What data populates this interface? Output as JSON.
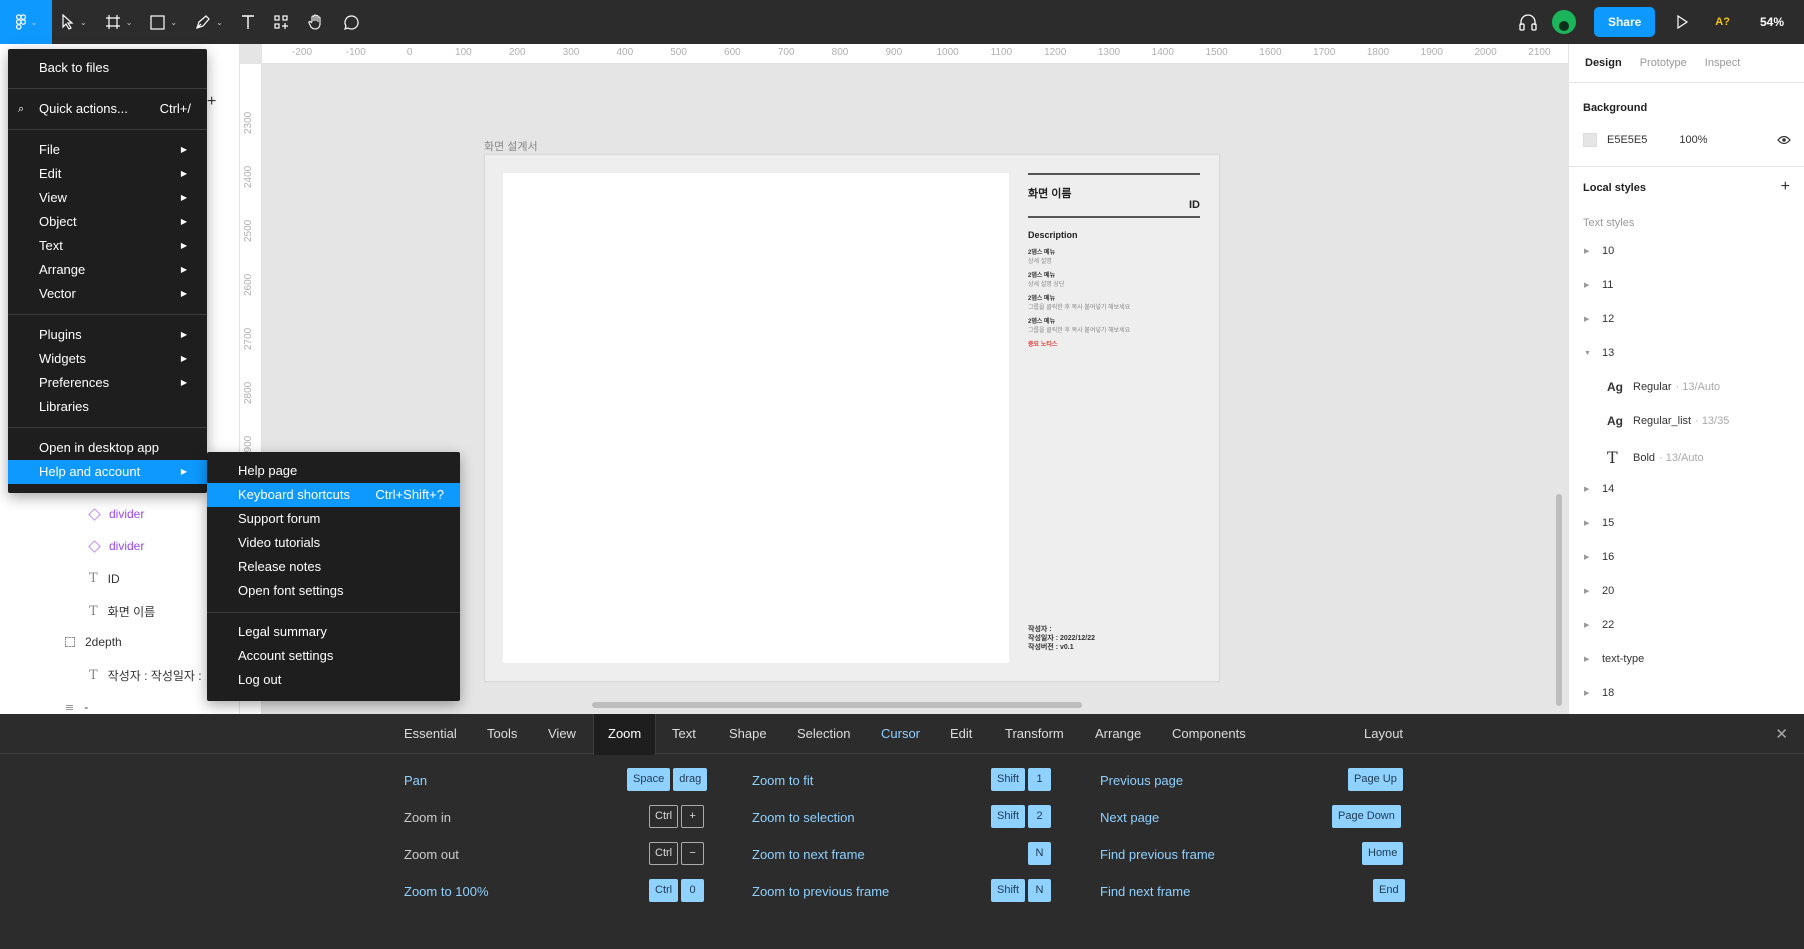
{
  "toolbar": {
    "share_label": "Share",
    "font_warning": "A?",
    "zoom": "54%"
  },
  "ruler": {
    "top_ticks": [
      "-200",
      "-100",
      "0",
      "100",
      "200",
      "300",
      "400",
      "500",
      "600",
      "700",
      "800",
      "900",
      "1000",
      "1100",
      "1200",
      "1300",
      "1400",
      "1500",
      "1600",
      "1700",
      "1800",
      "1900",
      "2000",
      "2100"
    ],
    "left_ticks": [
      "2300",
      "2400",
      "2500",
      "2600",
      "2700",
      "2800",
      "2900"
    ]
  },
  "layers": {
    "items": [
      {
        "label": "divider"
      },
      {
        "label": "divider"
      },
      {
        "label": "ID"
      },
      {
        "label": "화면 이름"
      },
      {
        "label": "2depth"
      },
      {
        "label": "작성자 : 작성일자 :"
      },
      {
        "label": "-"
      }
    ]
  },
  "canvas": {
    "frame_label": "화면 설계서",
    "screen_title": "화면 이름",
    "screen_id": "ID",
    "description": "Description",
    "depths": [
      {
        "head": "2뎁스 메뉴",
        "sub": "상세 설명"
      },
      {
        "head": "2뎁스 메뉴",
        "sub": "상세 설명 상단"
      },
      {
        "head": "2뎁스 메뉴",
        "sub": "그룹을 클릭한 후 복사 붙여넣기 해보세요"
      },
      {
        "head": "2뎁스 메뉴",
        "sub": "그룹을 클릭한 후 복사 붙여넣기 해보세요"
      }
    ],
    "notice": "중요 노티스",
    "footer_author": "작성자 :",
    "footer_date": "작성일자 : 2022/12/22",
    "footer_version": "작성버전 : v0.1"
  },
  "right_panel": {
    "tabs": [
      "Design",
      "Prototype",
      "Inspect"
    ],
    "background_title": "Background",
    "bg_hex": "E5E5E5",
    "bg_opacity": "100%",
    "local_styles_title": "Local styles",
    "text_styles_title": "Text styles",
    "style_groups": [
      "10",
      "11",
      "12",
      "13",
      "14",
      "15",
      "16",
      "20",
      "22",
      "text-type",
      "18"
    ],
    "expanded_styles": [
      {
        "icon": "Ag",
        "name": "Regular",
        "meta": "· 13/Auto"
      },
      {
        "icon": "Ag",
        "name": "Regular_list",
        "meta": "· 13/35"
      },
      {
        "icon": "T",
        "name": "Bold",
        "meta": "· 13/Auto"
      }
    ]
  },
  "main_menu": {
    "back": "Back to files",
    "quick_actions": "Quick actions...",
    "quick_actions_shortcut": "Ctrl+/",
    "file": "File",
    "edit": "Edit",
    "view": "View",
    "object": "Object",
    "text": "Text",
    "arrange": "Arrange",
    "vector": "Vector",
    "plugins": "Plugins",
    "widgets": "Widgets",
    "preferences": "Preferences",
    "libraries": "Libraries",
    "open_desktop": "Open in desktop app",
    "help_account": "Help and account"
  },
  "help_menu": {
    "help_page": "Help page",
    "keyboard_shortcuts": "Keyboard shortcuts",
    "keyboard_shortcuts_key": "Ctrl+Shift+?",
    "support_forum": "Support forum",
    "video_tutorials": "Video tutorials",
    "release_notes": "Release notes",
    "font_settings": "Open font settings",
    "legal_summary": "Legal summary",
    "account_settings": "Account settings",
    "log_out": "Log out"
  },
  "shortcuts": {
    "tabs": [
      "Essential",
      "Tools",
      "View",
      "Zoom",
      "Text",
      "Shape",
      "Selection",
      "Cursor",
      "Edit",
      "Transform",
      "Arrange",
      "Components",
      "Layout"
    ],
    "active_tab": "Zoom",
    "col1": [
      {
        "label": "Pan",
        "keys": [
          "Space",
          "drag"
        ]
      },
      {
        "label": "Zoom in",
        "keys": [
          "Ctrl",
          "+"
        ]
      },
      {
        "label": "Zoom out",
        "keys": [
          "Ctrl",
          "−"
        ]
      },
      {
        "label": "Zoom to 100%",
        "keys": [
          "Ctrl",
          "0"
        ]
      }
    ],
    "col2": [
      {
        "label": "Zoom to fit",
        "keys": [
          "Shift",
          "1"
        ]
      },
      {
        "label": "Zoom to selection",
        "keys": [
          "Shift",
          "2"
        ]
      },
      {
        "label": "Zoom to next frame",
        "keys": [
          "N"
        ]
      },
      {
        "label": "Zoom to previous frame",
        "keys": [
          "Shift",
          "N"
        ]
      }
    ],
    "col3": [
      {
        "label": "Previous page",
        "keys": [
          "Page Up"
        ]
      },
      {
        "label": "Next page",
        "keys": [
          "Page Down"
        ]
      },
      {
        "label": "Find previous frame",
        "keys": [
          "Home"
        ]
      },
      {
        "label": "Find next frame",
        "keys": [
          "End"
        ]
      }
    ]
  }
}
